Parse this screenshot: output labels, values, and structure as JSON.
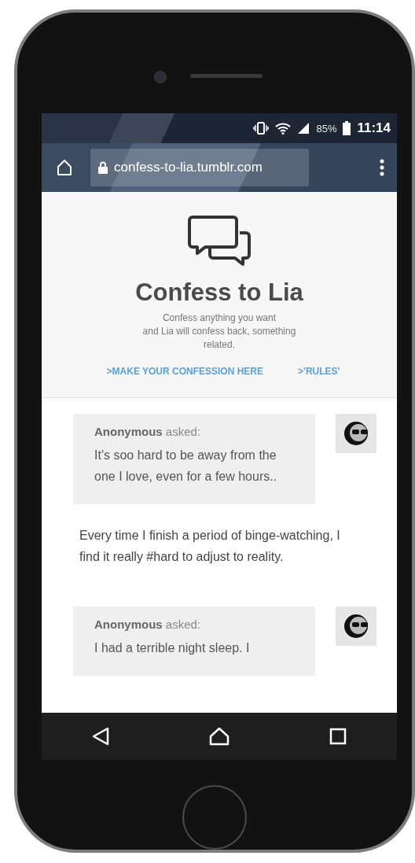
{
  "status_bar": {
    "battery": "85%",
    "time": "11:14"
  },
  "browser": {
    "url": "confess-to-lia.tumblr.com"
  },
  "blog": {
    "title": "Confess to Lia",
    "description": "Confess anything you want\nand Lia will confess back, something\nrelated.",
    "links": [
      ">MAKE YOUR CONFESSION HERE",
      ">'RULES'"
    ]
  },
  "posts": [
    {
      "asker": "**Anonymous** asked:",
      "question": "It's soo hard to be away from the one I love, even for a few hours..",
      "answer": "Every time I finish a period of binge-watching, I find it really #hard to adjust to reality."
    },
    {
      "asker": "**Anonymous** asked:",
      "question": "I had a terrible night sleep. I"
    }
  ]
}
